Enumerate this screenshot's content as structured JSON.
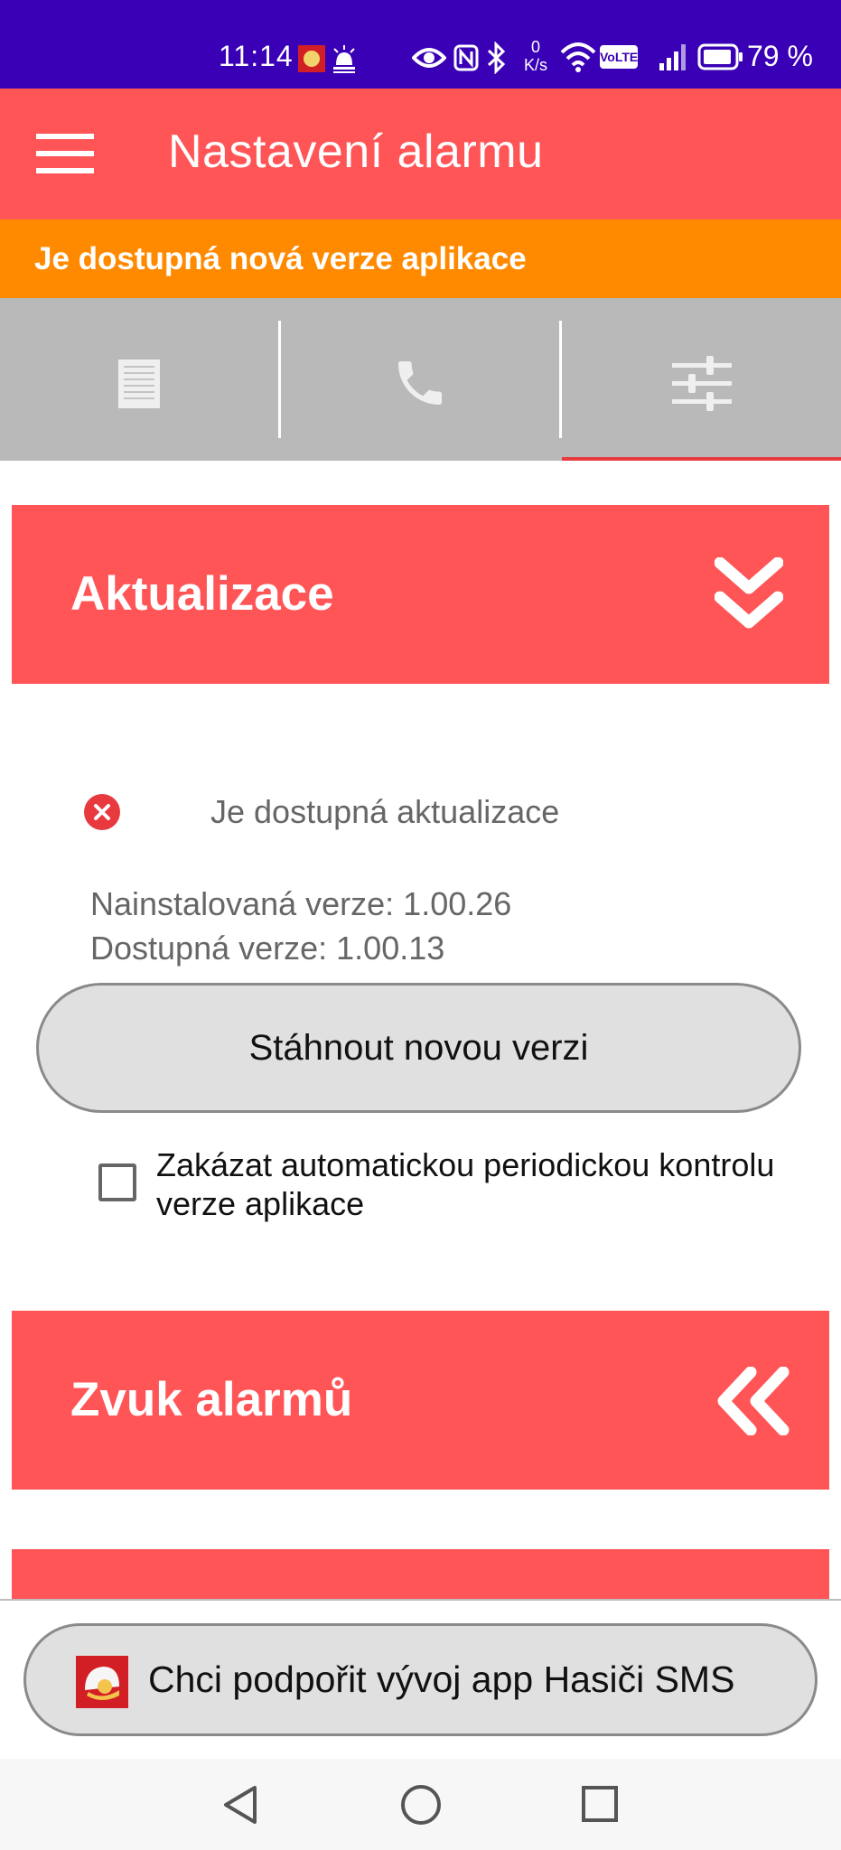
{
  "status_bar": {
    "time": "11:14",
    "net_speed_value": "0",
    "net_speed_unit": "K/s",
    "volte": "VoLTE",
    "battery_percent": "79 %"
  },
  "app_bar": {
    "title": "Nastavení alarmu"
  },
  "banner": {
    "text": "Je dostupná nová verze aplikace"
  },
  "tabs": [
    {
      "name": "list",
      "icon": "document-icon"
    },
    {
      "name": "phone",
      "icon": "phone-icon"
    },
    {
      "name": "settings",
      "icon": "sliders-icon",
      "selected": true
    }
  ],
  "sections": {
    "updates": {
      "title": "Aktualizace",
      "status_text": "Je dostupná aktualizace",
      "installed_version": "Nainstalovaná verze: 1.00.26",
      "available_version": "Dostupná verze: 1.00.13",
      "download_button": "Stáhnout novou verzi",
      "disable_check_label": "Zakázat automatickou periodickou kontrolu verze aplikace",
      "disable_check_checked": false
    },
    "alarm_sound": {
      "title": "Zvuk alarmů"
    }
  },
  "support_button": {
    "label": "Chci podpořit vývoj app Hasiči SMS"
  },
  "colors": {
    "status_bar": "#3a00b6",
    "accent_red": "#ff5557",
    "banner_orange": "#ff8a00",
    "tab_gray": "#b9b9b9",
    "error_red": "#e8393f"
  }
}
